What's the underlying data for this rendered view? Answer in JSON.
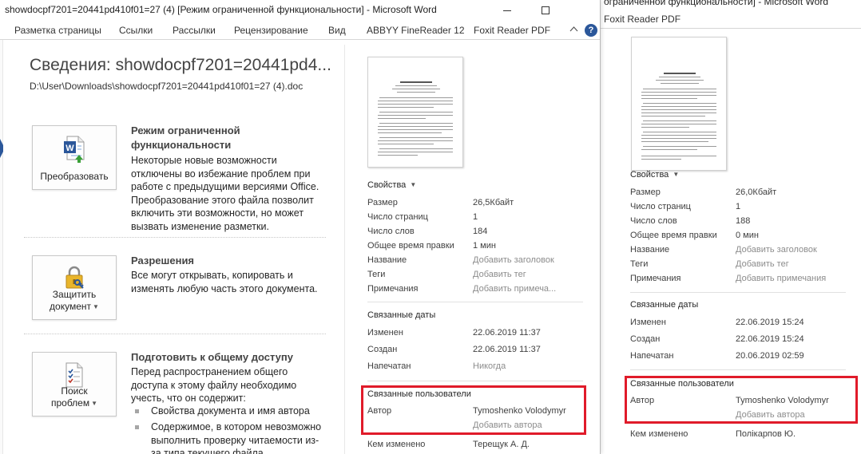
{
  "main_window": {
    "title": "showdocpf7201=20441pd410f01=27 (4) [Режим ограниченной функциональности]  -  Microsoft Word",
    "ribbon_tabs": [
      "Разметка страницы",
      "Ссылки",
      "Рассылки",
      "Рецензирование",
      "Вид",
      "ABBYY FineReader 12",
      "Foxit Reader PDF"
    ],
    "help": "?",
    "page_title": "Сведения: showdocpf7201=20441pd4...",
    "path": "D:\\User\\Downloads\\showdocpf7201=20441pd410f01=27 (4).doc",
    "sections": {
      "convert": {
        "button": "Преобразовать",
        "heading": "Режим ограниченной функциональности",
        "description": "Некоторые новые возможности отключены во избежание проблем при работе с предыдущими версиями Office. Преобразование этого файла позволит включить эти возможности, но может вызвать изменение разметки."
      },
      "permissions": {
        "button_line1": "Защитить",
        "button_line2": "документ",
        "heading": "Разрешения",
        "description": "Все могут открывать, копировать и изменять любую часть этого документа."
      },
      "inspect": {
        "button_line1": "Поиск",
        "button_line2": "проблем",
        "heading": "Подготовить к общему доступу",
        "description": "Перед распространением общего доступа к этому файлу необходимо учесть, что он содержит:",
        "bullets": [
          "Свойства документа и имя автора",
          "Содержимое, в котором невозможно выполнить проверку читаемости из-за типа текущего файла"
        ]
      }
    },
    "properties": {
      "title": "Свойства",
      "rows": [
        {
          "label": "Размер",
          "value": "26,5Кбайт"
        },
        {
          "label": "Число страниц",
          "value": "1"
        },
        {
          "label": "Число слов",
          "value": "184"
        },
        {
          "label": "Общее время правки",
          "value": "1 мин"
        },
        {
          "label": "Название",
          "value": "Добавить заголовок"
        },
        {
          "label": "Теги",
          "value": "Добавить тег"
        },
        {
          "label": "Примечания",
          "value": "Добавить примеча..."
        }
      ],
      "dates_title": "Связанные даты",
      "dates": [
        {
          "label": "Изменен",
          "value": "22.06.2019 11:37"
        },
        {
          "label": "Создан",
          "value": "22.06.2019 11:37"
        },
        {
          "label": "Напечатан",
          "value": "Никогда"
        }
      ],
      "people_title": "Связанные пользователи",
      "author_label": "Автор",
      "author_value": "Tymoshenko Volodymyr",
      "add_author": "Добавить автора",
      "modified_by_label": "Кем изменено",
      "modified_by_value": "Терещук А. Д."
    }
  },
  "right_window": {
    "title": "ограниченной функциональности]  -  Microsoft Word",
    "ribbon": "Foxit Reader PDF",
    "properties": {
      "title": "Свойства",
      "rows": [
        {
          "label": "Размер",
          "value": "26,0Кбайт"
        },
        {
          "label": "Число страниц",
          "value": "1"
        },
        {
          "label": "Число слов",
          "value": "188"
        },
        {
          "label": "Общее время правки",
          "value": "0 мин"
        },
        {
          "label": "Название",
          "value": "Добавить заголовок"
        },
        {
          "label": "Теги",
          "value": "Добавить тег"
        },
        {
          "label": "Примечания",
          "value": "Добавить примечания"
        }
      ],
      "dates_title": "Связанные даты",
      "dates": [
        {
          "label": "Изменен",
          "value": "22.06.2019 15:24"
        },
        {
          "label": "Создан",
          "value": "22.06.2019 15:24"
        },
        {
          "label": "Напечатан",
          "value": "20.06.2019 02:59"
        }
      ],
      "people_title": "Связанные пользователи",
      "author_label": "Автор",
      "author_value": "Tymoshenko Volodymyr",
      "add_author": "Добавить автора",
      "modified_by_label": "Кем изменено",
      "modified_by_value": "Полікарпов Ю."
    }
  },
  "colors": {
    "highlight_box": "#e01b2a",
    "word_blue": "#2b579a",
    "muted_text": "#8c8c8c"
  },
  "icons": [
    "word-convert-icon",
    "lock-key-icon",
    "document-check-icon",
    "chevron-up-icon",
    "help-icon",
    "minimize-icon",
    "maximize-icon",
    "caret-down-icon"
  ]
}
